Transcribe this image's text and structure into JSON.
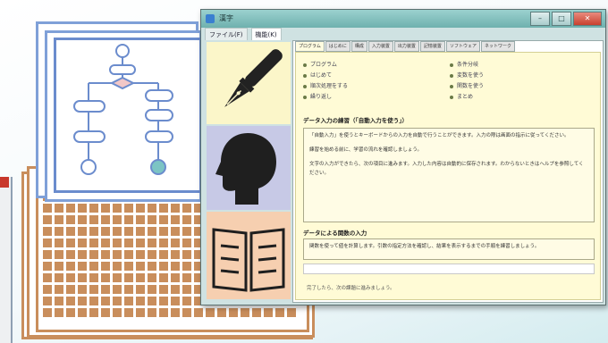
{
  "window": {
    "title": "漢字",
    "controls": {
      "minimize": "–",
      "maximize": "□",
      "close": "✕"
    }
  },
  "menu": [
    {
      "label": "ファイル(F)"
    },
    {
      "label": "機能(K)"
    }
  ],
  "tabs": [
    {
      "label": "プログラム"
    },
    {
      "label": "はじめに"
    },
    {
      "label": "構成"
    },
    {
      "label": "入力装置"
    },
    {
      "label": "出力装置"
    },
    {
      "label": "記憶装置"
    },
    {
      "label": "ソフトウェア"
    },
    {
      "label": "ネットワーク"
    }
  ],
  "options": [
    {
      "label": "プログラム"
    },
    {
      "label": "はじめて"
    },
    {
      "label": "順次処理をする"
    },
    {
      "label": "繰り返し"
    },
    {
      "label": "条件分岐"
    },
    {
      "label": "変数を使う"
    },
    {
      "label": "関数を使う"
    },
    {
      "label": "まとめ"
    }
  ],
  "sections": {
    "first_heading": "データ入力の練習（「自動入力を使う」）",
    "first_text": [
      "「自動入力」を使うとキーボードからの入力を自動で行うことができます。入力の際は画面の指示に従ってください。",
      "練習を始める前に、学習の流れを確認しましょう。",
      "文字の入力ができたら、次の項目に進みます。入力した内容は自動的に保存されます。わからないときはヘルプを参照してください。"
    ],
    "second_heading": "データによる関数の入力",
    "second_text": [
      "関数を使って値を計算します。引数の指定方法を確認し、結果を表示するまでの手順を練習しましょう。"
    ],
    "third_text": "完了したら、次の課題に進みましょう。"
  },
  "colors": {
    "title_bar": "#8cc5c3",
    "panel_bg": "#fffbd6",
    "grid_brown": "#c98e5c",
    "flow_blue": "#6b8ccd",
    "tile_yellow": "#fbf6c9",
    "tile_lavender": "#c7c9e6",
    "tile_peach": "#f6cfb0"
  },
  "icons": [
    "fountain-pen-icon",
    "head-silhouette-icon",
    "open-book-icon",
    "flowchart-icon"
  ]
}
